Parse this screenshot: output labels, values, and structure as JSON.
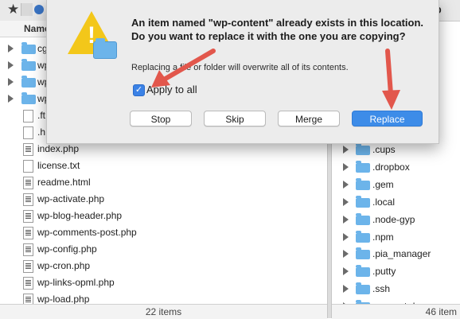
{
  "toolbar": {
    "right_label": "D"
  },
  "left_pane": {
    "header": "Name",
    "rows": [
      {
        "type": "folder",
        "label": "cg",
        "expandable": true
      },
      {
        "type": "folder",
        "label": "wp",
        "expandable": true
      },
      {
        "type": "folder",
        "label": "wp",
        "expandable": true
      },
      {
        "type": "folder",
        "label": "wp",
        "expandable": true
      },
      {
        "type": "file",
        "label": ".ft"
      },
      {
        "type": "file",
        "label": ".h"
      },
      {
        "type": "php",
        "label": "index.php"
      },
      {
        "type": "file",
        "label": "license.txt"
      },
      {
        "type": "php",
        "label": "readme.html"
      },
      {
        "type": "php",
        "label": "wp-activate.php"
      },
      {
        "type": "php",
        "label": "wp-blog-header.php"
      },
      {
        "type": "php",
        "label": "wp-comments-post.php"
      },
      {
        "type": "php",
        "label": "wp-config.php"
      },
      {
        "type": "php",
        "label": "wp-cron.php"
      },
      {
        "type": "php",
        "label": "wp-links-opml.php"
      },
      {
        "type": "php",
        "label": "wp-load.php"
      }
    ],
    "footer": "22 items"
  },
  "right_pane": {
    "partial_label": "p",
    "rows": [
      ".cups",
      ".dropbox",
      ".gem",
      ".local",
      ".node-gyp",
      ".npm",
      ".pia_manager",
      ".putty",
      ".ssh",
      ".vagrant.d"
    ],
    "footer": "46 item"
  },
  "dialog": {
    "title": "An item named \"wp-content\" already exists in this location. Do you want to replace it with the one you are copying?",
    "subtitle": "Replacing a file or folder will overwrite all of its contents.",
    "apply_all_label": "Apply to all",
    "apply_all_checked": true,
    "buttons": {
      "stop": "Stop",
      "skip": "Skip",
      "merge": "Merge",
      "replace": "Replace"
    }
  },
  "colors": {
    "accent": "#3d8ce8",
    "annotation": "#e2574c",
    "warning": "#f3c71a",
    "folder": "#6cb4ea"
  },
  "icons": {
    "warning": "warning-triangle-icon",
    "folder": "folder-icon",
    "checkmark": "check-icon",
    "star": "star-icon"
  }
}
